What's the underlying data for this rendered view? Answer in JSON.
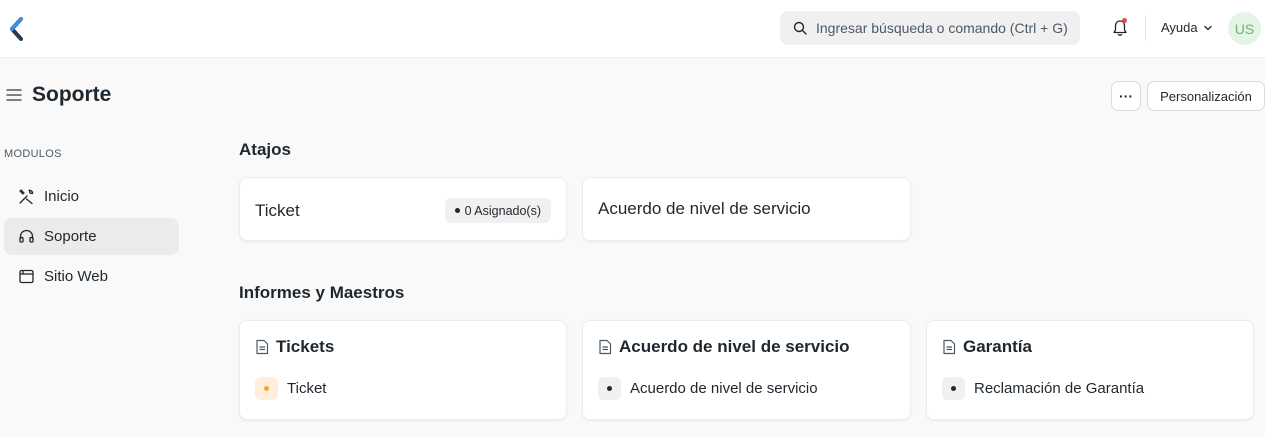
{
  "navbar": {
    "search_placeholder": "Ingresar búsqueda o comando (Ctrl + G)",
    "help_label": "Ayuda",
    "avatar_initials": "US"
  },
  "page": {
    "title": "Soporte",
    "more_label": "···",
    "customize_label": "Personalización"
  },
  "sidebar": {
    "section_label": "MODULOS",
    "items": [
      {
        "label": "Inicio",
        "icon": "tools-icon"
      },
      {
        "label": "Soporte",
        "icon": "headset-icon",
        "active": true
      },
      {
        "label": "Sitio Web",
        "icon": "browser-icon"
      }
    ]
  },
  "shortcuts": {
    "title": "Atajos",
    "items": [
      {
        "label": "Ticket",
        "badge": "0 Asignado(s)"
      },
      {
        "label": "Acuerdo de nivel de servicio"
      }
    ]
  },
  "reports": {
    "title": "Informes y Maestros",
    "cards": [
      {
        "title": "Tickets",
        "links": [
          "Ticket"
        ],
        "accent": "#f0a43f"
      },
      {
        "title": "Acuerdo de nivel de servicio",
        "links": [
          "Acuerdo de nivel de servicio"
        ]
      },
      {
        "title": "Garantía",
        "links": [
          "Reclamación de Garantía"
        ]
      }
    ]
  },
  "colors": {
    "notification_dot": "#e24c4c",
    "avatar_bg": "#e5f4e7",
    "avatar_fg": "#69b56f"
  }
}
